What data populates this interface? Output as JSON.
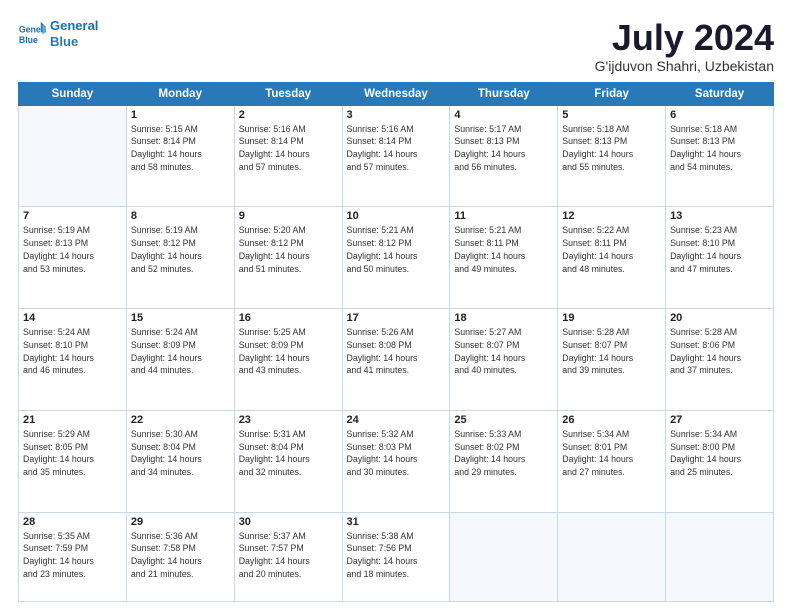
{
  "header": {
    "logo_line1": "General",
    "logo_line2": "Blue",
    "month_title": "July 2024",
    "location": "G'ijduvon Shahri, Uzbekistan"
  },
  "days_of_week": [
    "Sunday",
    "Monday",
    "Tuesday",
    "Wednesday",
    "Thursday",
    "Friday",
    "Saturday"
  ],
  "weeks": [
    [
      {
        "day": "",
        "empty": true
      },
      {
        "day": "1",
        "sunrise": "Sunrise: 5:15 AM",
        "sunset": "Sunset: 8:14 PM",
        "daylight": "Daylight: 14 hours",
        "daylight2": "and 58 minutes."
      },
      {
        "day": "2",
        "sunrise": "Sunrise: 5:16 AM",
        "sunset": "Sunset: 8:14 PM",
        "daylight": "Daylight: 14 hours",
        "daylight2": "and 57 minutes."
      },
      {
        "day": "3",
        "sunrise": "Sunrise: 5:16 AM",
        "sunset": "Sunset: 8:14 PM",
        "daylight": "Daylight: 14 hours",
        "daylight2": "and 57 minutes."
      },
      {
        "day": "4",
        "sunrise": "Sunrise: 5:17 AM",
        "sunset": "Sunset: 8:13 PM",
        "daylight": "Daylight: 14 hours",
        "daylight2": "and 56 minutes."
      },
      {
        "day": "5",
        "sunrise": "Sunrise: 5:18 AM",
        "sunset": "Sunset: 8:13 PM",
        "daylight": "Daylight: 14 hours",
        "daylight2": "and 55 minutes."
      },
      {
        "day": "6",
        "sunrise": "Sunrise: 5:18 AM",
        "sunset": "Sunset: 8:13 PM",
        "daylight": "Daylight: 14 hours",
        "daylight2": "and 54 minutes."
      }
    ],
    [
      {
        "day": "7",
        "sunrise": "Sunrise: 5:19 AM",
        "sunset": "Sunset: 8:13 PM",
        "daylight": "Daylight: 14 hours",
        "daylight2": "and 53 minutes."
      },
      {
        "day": "8",
        "sunrise": "Sunrise: 5:19 AM",
        "sunset": "Sunset: 8:12 PM",
        "daylight": "Daylight: 14 hours",
        "daylight2": "and 52 minutes."
      },
      {
        "day": "9",
        "sunrise": "Sunrise: 5:20 AM",
        "sunset": "Sunset: 8:12 PM",
        "daylight": "Daylight: 14 hours",
        "daylight2": "and 51 minutes."
      },
      {
        "day": "10",
        "sunrise": "Sunrise: 5:21 AM",
        "sunset": "Sunset: 8:12 PM",
        "daylight": "Daylight: 14 hours",
        "daylight2": "and 50 minutes."
      },
      {
        "day": "11",
        "sunrise": "Sunrise: 5:21 AM",
        "sunset": "Sunset: 8:11 PM",
        "daylight": "Daylight: 14 hours",
        "daylight2": "and 49 minutes."
      },
      {
        "day": "12",
        "sunrise": "Sunrise: 5:22 AM",
        "sunset": "Sunset: 8:11 PM",
        "daylight": "Daylight: 14 hours",
        "daylight2": "and 48 minutes."
      },
      {
        "day": "13",
        "sunrise": "Sunrise: 5:23 AM",
        "sunset": "Sunset: 8:10 PM",
        "daylight": "Daylight: 14 hours",
        "daylight2": "and 47 minutes."
      }
    ],
    [
      {
        "day": "14",
        "sunrise": "Sunrise: 5:24 AM",
        "sunset": "Sunset: 8:10 PM",
        "daylight": "Daylight: 14 hours",
        "daylight2": "and 46 minutes."
      },
      {
        "day": "15",
        "sunrise": "Sunrise: 5:24 AM",
        "sunset": "Sunset: 8:09 PM",
        "daylight": "Daylight: 14 hours",
        "daylight2": "and 44 minutes."
      },
      {
        "day": "16",
        "sunrise": "Sunrise: 5:25 AM",
        "sunset": "Sunset: 8:09 PM",
        "daylight": "Daylight: 14 hours",
        "daylight2": "and 43 minutes."
      },
      {
        "day": "17",
        "sunrise": "Sunrise: 5:26 AM",
        "sunset": "Sunset: 8:08 PM",
        "daylight": "Daylight: 14 hours",
        "daylight2": "and 41 minutes."
      },
      {
        "day": "18",
        "sunrise": "Sunrise: 5:27 AM",
        "sunset": "Sunset: 8:07 PM",
        "daylight": "Daylight: 14 hours",
        "daylight2": "and 40 minutes."
      },
      {
        "day": "19",
        "sunrise": "Sunrise: 5:28 AM",
        "sunset": "Sunset: 8:07 PM",
        "daylight": "Daylight: 14 hours",
        "daylight2": "and 39 minutes."
      },
      {
        "day": "20",
        "sunrise": "Sunrise: 5:28 AM",
        "sunset": "Sunset: 8:06 PM",
        "daylight": "Daylight: 14 hours",
        "daylight2": "and 37 minutes."
      }
    ],
    [
      {
        "day": "21",
        "sunrise": "Sunrise: 5:29 AM",
        "sunset": "Sunset: 8:05 PM",
        "daylight": "Daylight: 14 hours",
        "daylight2": "and 35 minutes."
      },
      {
        "day": "22",
        "sunrise": "Sunrise: 5:30 AM",
        "sunset": "Sunset: 8:04 PM",
        "daylight": "Daylight: 14 hours",
        "daylight2": "and 34 minutes."
      },
      {
        "day": "23",
        "sunrise": "Sunrise: 5:31 AM",
        "sunset": "Sunset: 8:04 PM",
        "daylight": "Daylight: 14 hours",
        "daylight2": "and 32 minutes."
      },
      {
        "day": "24",
        "sunrise": "Sunrise: 5:32 AM",
        "sunset": "Sunset: 8:03 PM",
        "daylight": "Daylight: 14 hours",
        "daylight2": "and 30 minutes."
      },
      {
        "day": "25",
        "sunrise": "Sunrise: 5:33 AM",
        "sunset": "Sunset: 8:02 PM",
        "daylight": "Daylight: 14 hours",
        "daylight2": "and 29 minutes."
      },
      {
        "day": "26",
        "sunrise": "Sunrise: 5:34 AM",
        "sunset": "Sunset: 8:01 PM",
        "daylight": "Daylight: 14 hours",
        "daylight2": "and 27 minutes."
      },
      {
        "day": "27",
        "sunrise": "Sunrise: 5:34 AM",
        "sunset": "Sunset: 8:00 PM",
        "daylight": "Daylight: 14 hours",
        "daylight2": "and 25 minutes."
      }
    ],
    [
      {
        "day": "28",
        "sunrise": "Sunrise: 5:35 AM",
        "sunset": "Sunset: 7:59 PM",
        "daylight": "Daylight: 14 hours",
        "daylight2": "and 23 minutes."
      },
      {
        "day": "29",
        "sunrise": "Sunrise: 5:36 AM",
        "sunset": "Sunset: 7:58 PM",
        "daylight": "Daylight: 14 hours",
        "daylight2": "and 21 minutes."
      },
      {
        "day": "30",
        "sunrise": "Sunrise: 5:37 AM",
        "sunset": "Sunset: 7:57 PM",
        "daylight": "Daylight: 14 hours",
        "daylight2": "and 20 minutes."
      },
      {
        "day": "31",
        "sunrise": "Sunrise: 5:38 AM",
        "sunset": "Sunset: 7:56 PM",
        "daylight": "Daylight: 14 hours",
        "daylight2": "and 18 minutes."
      },
      {
        "day": "",
        "empty": true
      },
      {
        "day": "",
        "empty": true
      },
      {
        "day": "",
        "empty": true
      }
    ]
  ]
}
